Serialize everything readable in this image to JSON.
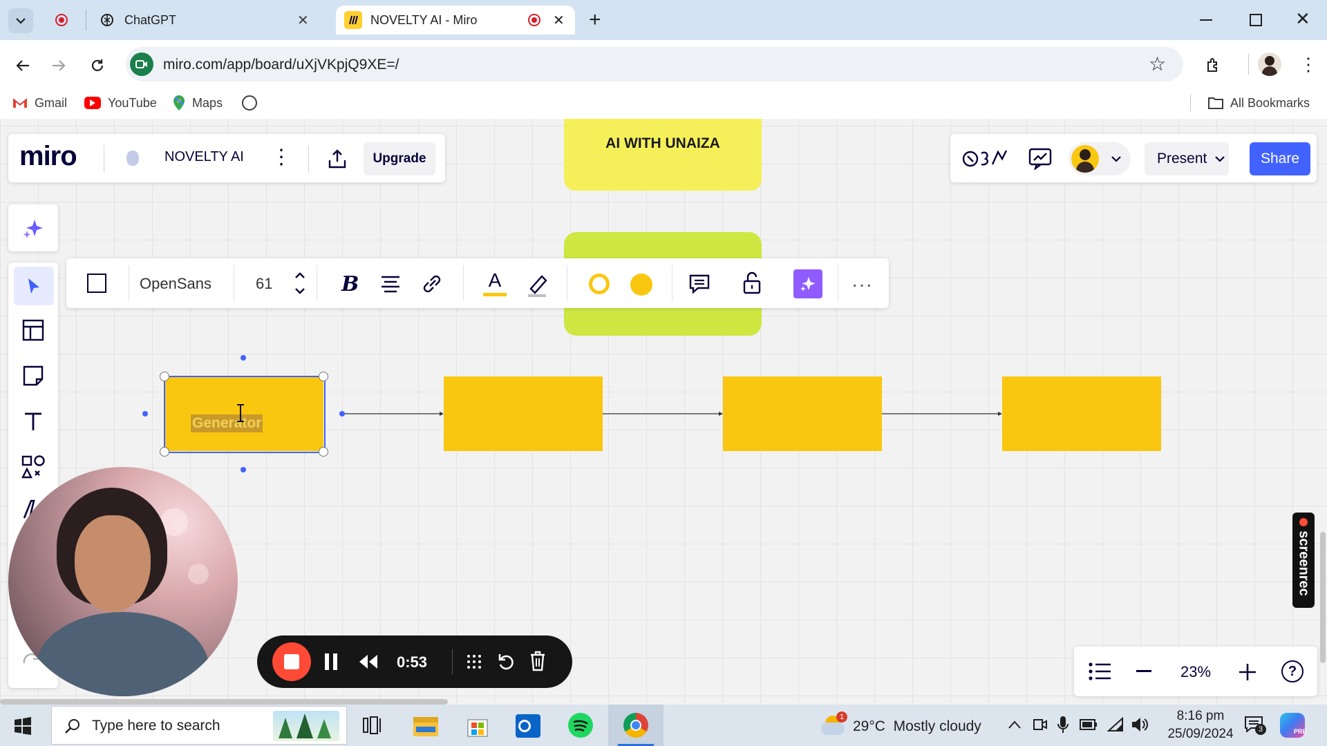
{
  "browser": {
    "tabs": [
      {
        "title": "ChatGPT",
        "active": false
      },
      {
        "title": "NOVELTY AI - Miro",
        "active": true
      }
    ],
    "url": "miro.com/app/board/uXjVKpjQ9XE=/",
    "bookmarks": [
      "Gmail",
      "YouTube",
      "Maps"
    ],
    "all_bookmarks_label": "All Bookmarks"
  },
  "miro": {
    "logo": "miro",
    "board_name": "NOVELTY AI",
    "upgrade_label": "Upgrade",
    "present_label": "Present",
    "share_label": "Share",
    "zoom": "23%",
    "accent_color": "#4262ff"
  },
  "canvas": {
    "title_note": "AI WITH UNAIZA",
    "selected_box_text": "Generator",
    "box_color": "#fac710",
    "note_color": "#f5f05a",
    "green_note_color": "#cee741"
  },
  "format_toolbar": {
    "font": "OpenSans",
    "font_size": "61"
  },
  "recorder": {
    "time": "0:53",
    "brand": "screenrec"
  },
  "taskbar": {
    "search_placeholder": "Type here to search",
    "weather": "29°C  Mostly cloudy",
    "time": "8:16 pm",
    "date": "25/09/2024",
    "notification_count": "3"
  }
}
